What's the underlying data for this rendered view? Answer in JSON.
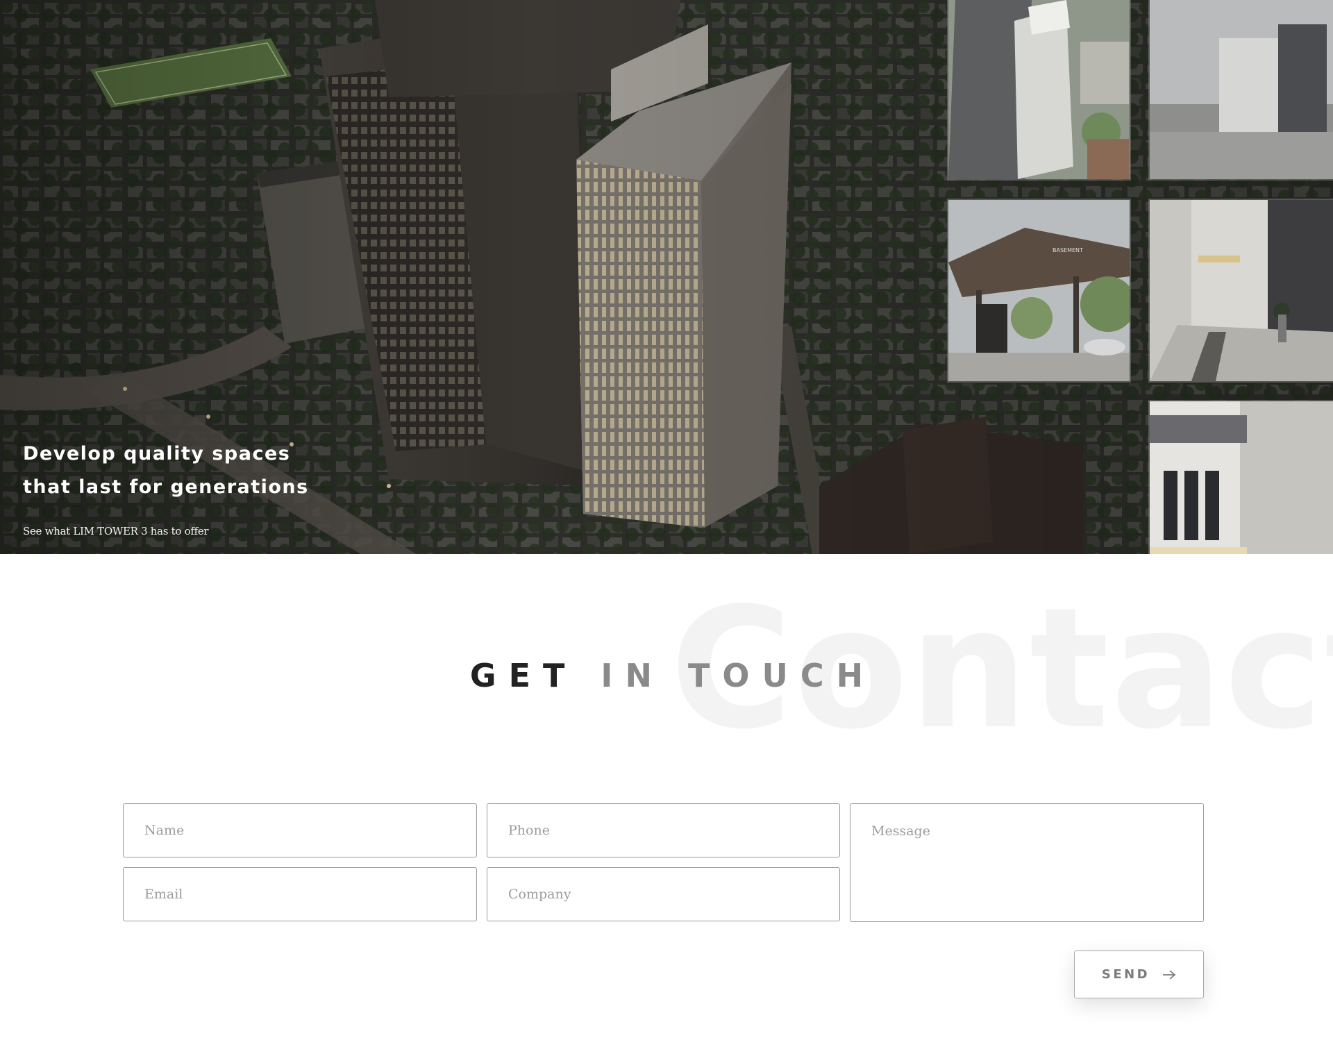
{
  "hero": {
    "headline_line1": "Develop quality spaces",
    "headline_line2": "that last for generations",
    "subtext": "See what LIM TOWER 3 has to offer",
    "thumbnails": [
      {
        "name": "thumbnail-aerial-day",
        "icon": "gallery-image"
      },
      {
        "name": "thumbnail-skyline",
        "icon": "gallery-image"
      },
      {
        "name": "thumbnail-entrance-canopy",
        "icon": "gallery-image",
        "sign_text": "BASEMENT"
      },
      {
        "name": "thumbnail-walkway",
        "icon": "gallery-image"
      },
      {
        "name": "thumbnail-facade-corner",
        "icon": "gallery-image"
      }
    ]
  },
  "contact": {
    "watermark": "Contact",
    "title_dark": "GET",
    "title_light": "IN TOUCH",
    "form": {
      "name_placeholder": "Name",
      "phone_placeholder": "Phone",
      "email_placeholder": "Email",
      "company_placeholder": "Company",
      "message_placeholder": "Message",
      "send_label": "SEND",
      "send_icon": "arrow-right-icon"
    }
  },
  "colors": {
    "title_dark": "#222222",
    "title_light": "#8a8a8a",
    "watermark": "#f3f3f3",
    "field_border": "#9a9a9a",
    "send_text": "#7b7b7b"
  }
}
